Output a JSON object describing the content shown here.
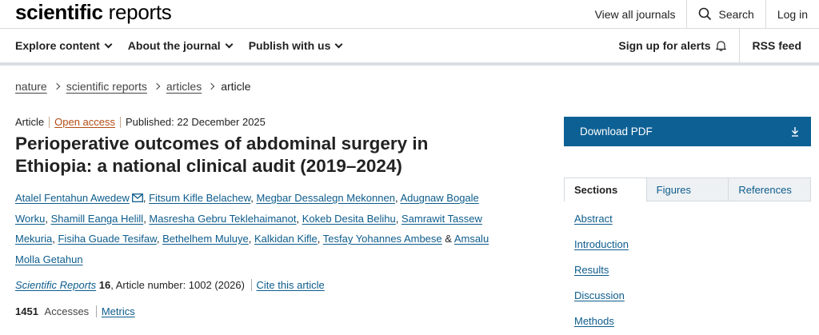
{
  "header": {
    "logo_bold": "scientific",
    "logo_light": "reports",
    "view_all_journals": "View all journals",
    "search_label": "Search",
    "login_label": "Log in"
  },
  "nav": {
    "explore": "Explore content",
    "about": "About the journal",
    "publish": "Publish with us",
    "alerts": "Sign up for alerts",
    "rss": "RSS feed"
  },
  "breadcrumb": {
    "items": [
      "nature",
      "scientific reports",
      "articles"
    ],
    "current": "article"
  },
  "article": {
    "type": "Article",
    "access": "Open access",
    "published": "Published: 22 December 2025",
    "title": "Perioperative outcomes of abdominal surgery in Ethiopia: a national clinical audit (2019–2024)",
    "authors": [
      "Atalel Fentahun Awedew",
      "Fitsum Kifle Belachew",
      "Megbar Dessalegn Mekonnen",
      "Adugnaw Bogale Worku",
      "Shamill Eanga Helill",
      "Masresha Gebru Teklehaimanot",
      "Kokeb Desita Belihu",
      "Samrawit Tassew Mekuria",
      "Fisiha Guade Tesifaw",
      "Bethelhem Muluye",
      "Kalkidan Kifle",
      "Tesfay Yohannes Ambese",
      "Amsalu Molla Getahun"
    ],
    "journal_name": "Scientific Reports",
    "volume": "16",
    "article_number": ", Article number: 1002 (2026)",
    "cite_label": "Cite this article",
    "accesses_count": "1451",
    "accesses_label": "Accesses",
    "metrics_label": "Metrics"
  },
  "sidebar": {
    "download_label": "Download PDF",
    "tabs": [
      "Sections",
      "Figures",
      "References"
    ],
    "sections": [
      "Abstract",
      "Introduction",
      "Results",
      "Discussion",
      "Methods"
    ]
  },
  "colors": {
    "link": "#0d5c8c",
    "download_bg": "#0d6094",
    "open_access": "#b34c14"
  }
}
